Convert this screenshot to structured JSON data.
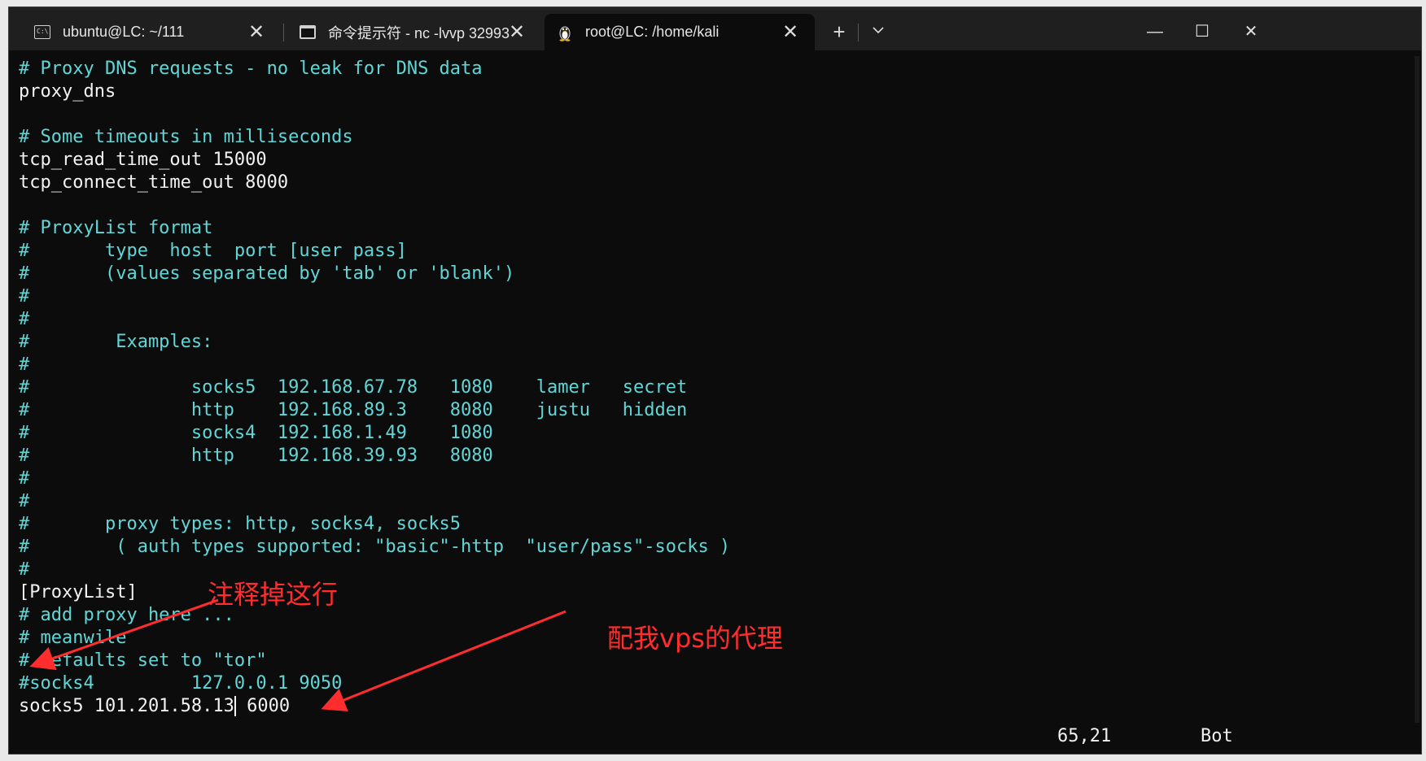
{
  "tabs": [
    {
      "title": "ubuntu@LC: ~/111",
      "icon": "cmd-icon"
    },
    {
      "title": "命令提示符 - nc  -lvvp 32993",
      "icon": "cmd-prompt-icon"
    },
    {
      "title": "root@LC: /home/kali",
      "icon": "linux-penguin-icon"
    }
  ],
  "toolbar": {
    "new_tab": "+",
    "dropdown": "⌄"
  },
  "window_controls": {
    "minimize": "—",
    "maximize": "☐",
    "close": "✕"
  },
  "terminal_lines": [
    {
      "text": "# Proxy DNS requests - no leak for DNS data",
      "color": "cyan"
    },
    {
      "text": "proxy_dns",
      "color": "white"
    },
    {
      "text": "",
      "color": "white"
    },
    {
      "text": "# Some timeouts in milliseconds",
      "color": "cyan"
    },
    {
      "text": "tcp_read_time_out 15000",
      "color": "white"
    },
    {
      "text": "tcp_connect_time_out 8000",
      "color": "white"
    },
    {
      "text": "",
      "color": "white"
    },
    {
      "text": "# ProxyList format",
      "color": "cyan"
    },
    {
      "text": "#       type  host  port [user pass]",
      "color": "cyan"
    },
    {
      "text": "#       (values separated by 'tab' or 'blank')",
      "color": "cyan"
    },
    {
      "text": "#",
      "color": "cyan"
    },
    {
      "text": "#",
      "color": "cyan"
    },
    {
      "text": "#        Examples:",
      "color": "cyan"
    },
    {
      "text": "#",
      "color": "cyan"
    },
    {
      "text": "#               socks5  192.168.67.78   1080    lamer   secret",
      "color": "cyan"
    },
    {
      "text": "#               http    192.168.89.3    8080    justu   hidden",
      "color": "cyan"
    },
    {
      "text": "#               socks4  192.168.1.49    1080",
      "color": "cyan"
    },
    {
      "text": "#               http    192.168.39.93   8080",
      "color": "cyan"
    },
    {
      "text": "#",
      "color": "cyan"
    },
    {
      "text": "#",
      "color": "cyan"
    },
    {
      "text": "#       proxy types: http, socks4, socks5",
      "color": "cyan"
    },
    {
      "text": "#        ( auth types supported: \"basic\"-http  \"user/pass\"-socks )",
      "color": "cyan"
    },
    {
      "text": "#",
      "color": "cyan"
    },
    {
      "text": "[ProxyList]",
      "color": "white"
    },
    {
      "text": "# add proxy here ...",
      "color": "cyan"
    },
    {
      "text": "# meanwile",
      "color": "cyan"
    },
    {
      "text": "# defaults set to \"tor\"",
      "color": "cyan"
    },
    {
      "text": "#socks4         127.0.0.1 9050",
      "color": "cyan"
    }
  ],
  "last_line": {
    "before_cursor": "socks5 101.201.58.13",
    "after_cursor": " 6000"
  },
  "status": {
    "position": "65,21",
    "scroll": "Bot"
  },
  "annotations": {
    "comment_out": "注释掉这行",
    "vps_proxy": "配我vps的代理",
    "color": "#ff2d2d"
  }
}
